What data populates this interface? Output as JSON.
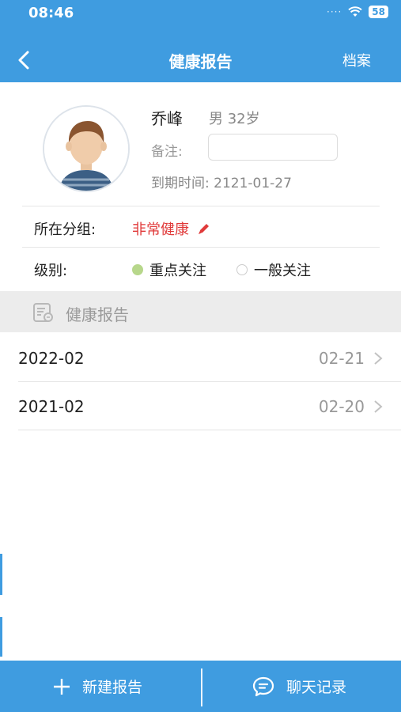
{
  "status": {
    "time": "08:46",
    "battery": "58"
  },
  "nav": {
    "title": "健康报告",
    "action": "档案"
  },
  "profile": {
    "name": "乔峰",
    "gender_age": "男 32岁",
    "remark_label": "备注:",
    "remark_value": "",
    "expire": "到期时间: 2121-01-27"
  },
  "group": {
    "label": "所在分组:",
    "value": "非常健康"
  },
  "level": {
    "label": "级别:",
    "options": [
      "重点关注",
      "一般关注"
    ],
    "selected": "重点关注"
  },
  "section": {
    "title": "健康报告"
  },
  "reports": [
    {
      "date": "2022-02",
      "sub": "02-21"
    },
    {
      "date": "2021-02",
      "sub": "02-20"
    }
  ],
  "bottom": {
    "new_report": "新建报告",
    "chat": "聊天记录"
  },
  "colors": {
    "primary": "#3f9ce0",
    "alert": "#e03a3a",
    "radio_selected": "#b7d78b"
  }
}
